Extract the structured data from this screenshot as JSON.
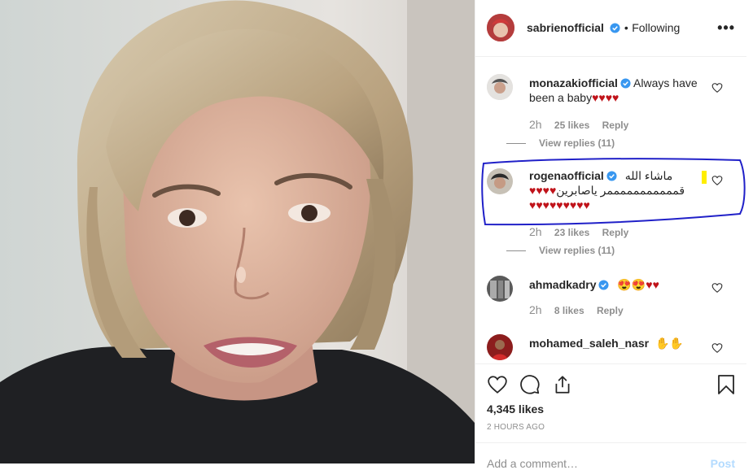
{
  "post": {
    "author": "sabrienofficial",
    "follow_state": "Following",
    "dot": "•",
    "more": "•••"
  },
  "comments": [
    {
      "username": "monazakiofficial",
      "text": "Always have",
      "text_line2": "been a baby",
      "hearts_line2": "♥♥♥♥",
      "time": "2h",
      "likes": "25 likes",
      "reply": "Reply",
      "view_replies": "View replies (11)"
    },
    {
      "username": "rogenaofficial",
      "text": "ماشاء الله",
      "text_line2_hearts": "♥♥♥♥",
      "text_line2": "قمممممممممممر ياصابرين",
      "hearts_line3": "♥♥♥♥♥♥♥♥♥",
      "time": "2h",
      "likes": "23 likes",
      "reply": "Reply",
      "view_replies": "View replies (11)"
    },
    {
      "username": "ahmadkadry",
      "emoji": "😍😍",
      "hearts": "♥♥",
      "time": "2h",
      "likes": "8 likes",
      "reply": "Reply"
    },
    {
      "username": "mohamed_saleh_nasr",
      "emoji": "✋✋"
    }
  ],
  "footer": {
    "likes": "4,345 likes",
    "time_ago": "2 HOURS AGO",
    "add_comment_placeholder": "Add a comment…",
    "post_label": "Post"
  },
  "icons": {
    "like": "heart-icon",
    "comment": "comment-icon",
    "share": "share-icon",
    "save": "bookmark-icon",
    "verified": "verified-badge-icon"
  },
  "colors": {
    "verified": "#3897f0",
    "heart_red": "#c0131a",
    "annotation": "#2020c8",
    "marker": "#ffee00"
  }
}
